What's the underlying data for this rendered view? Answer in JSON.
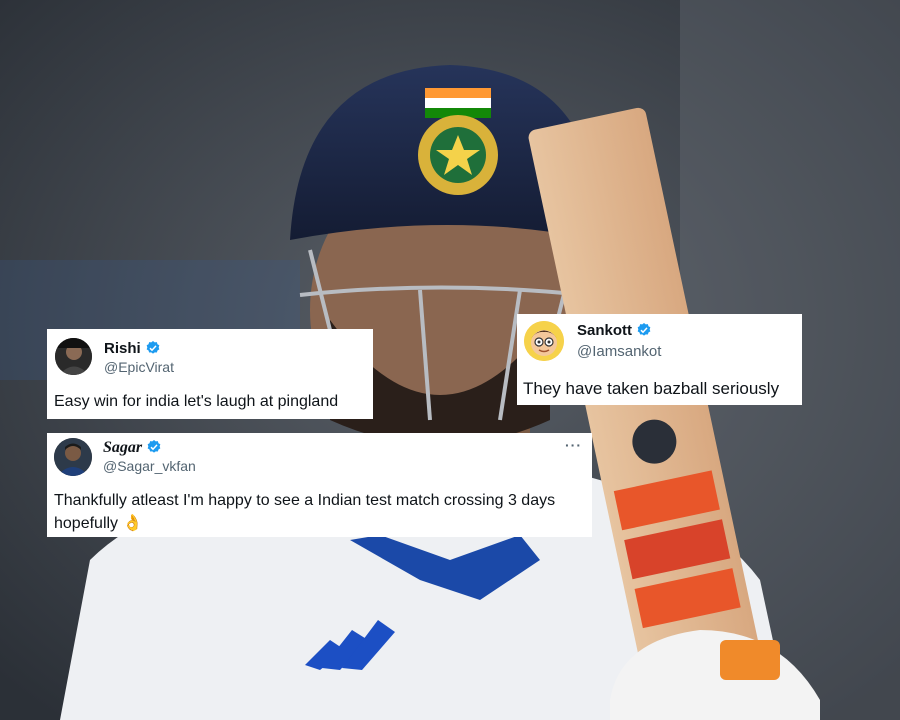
{
  "tweets": [
    {
      "name": "Rishi",
      "handle": "@EpicVirat",
      "text": "Easy win for india let's laugh at pingland",
      "avatar_icon": "profile-photo",
      "verified_icon": "verified-badge-icon"
    },
    {
      "name": "Sankott",
      "handle": "@Iamsankot",
      "text": "They have taken bazball seriously",
      "avatar_icon": "cartoon-face-avatar",
      "verified_icon": "verified-badge-icon"
    },
    {
      "name": "Sagar",
      "handle": "@Sagar_vkfan",
      "text": "Thankfully atleast I'm happy to see a Indian test match crossing 3 days hopefully 👌",
      "more_label": "···",
      "avatar_icon": "profile-photo",
      "verified_icon": "verified-badge-icon"
    }
  ],
  "colors": {
    "verified": "#1d9bf0",
    "handle": "#536471",
    "text": "#0f1419",
    "helmet": "#1e2a4a",
    "jersey": "#f2f3f5"
  }
}
